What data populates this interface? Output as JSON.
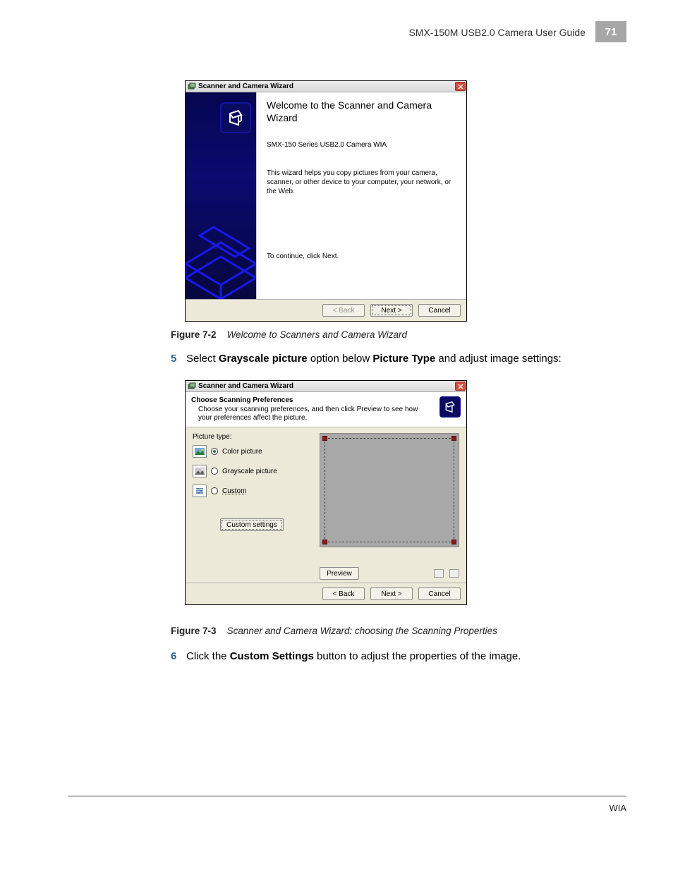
{
  "header": {
    "guide_title": "SMX-150M USB2.0 Camera User Guide",
    "page_number": "71"
  },
  "captions": {
    "fig1_label": "Figure 7-2",
    "fig1_text": "Welcome to Scanners and Camera Wizard",
    "fig2_label": "Figure 7-3",
    "fig2_text": "Scanner and Camera Wizard: choosing the Scanning Properties"
  },
  "steps": {
    "s5_num": "5",
    "s5_a": "Select ",
    "s5_b": "Grayscale picture",
    "s5_c": " option below ",
    "s5_d": "Picture Type",
    "s5_e": " and adjust image settings:",
    "s6_num": "6",
    "s6_a": "Click the ",
    "s6_b": "Custom Settings",
    "s6_c": " button to adjust the properties of the image."
  },
  "wizard1": {
    "title": "Scanner and Camera Wizard",
    "heading_l1": "Welcome to the Scanner and Camera",
    "heading_l2": "Wizard",
    "device": "SMX-150 Series USB2.0 Camera WIA",
    "desc": "This wizard helps you copy pictures from your camera, scanner, or other device to your computer, your network, or the Web.",
    "continue": "To continue, click Next.",
    "back": "< Back",
    "next": "Next >",
    "cancel": "Cancel"
  },
  "wizard2": {
    "title": "Scanner and Camera Wizard",
    "head_title": "Choose Scanning Preferences",
    "head_sub": "Choose your scanning preferences, and then click Preview to see how your preferences affect the picture.",
    "ptype_label": "Picture type:",
    "opt_color": "Color picture",
    "opt_gray": "Grayscale picture",
    "opt_custom": "Custom",
    "custom_settings": "Custom settings",
    "preview": "Preview",
    "back": "< Back",
    "next": "Next >",
    "cancel": "Cancel"
  },
  "footer": {
    "section": "WIA"
  }
}
